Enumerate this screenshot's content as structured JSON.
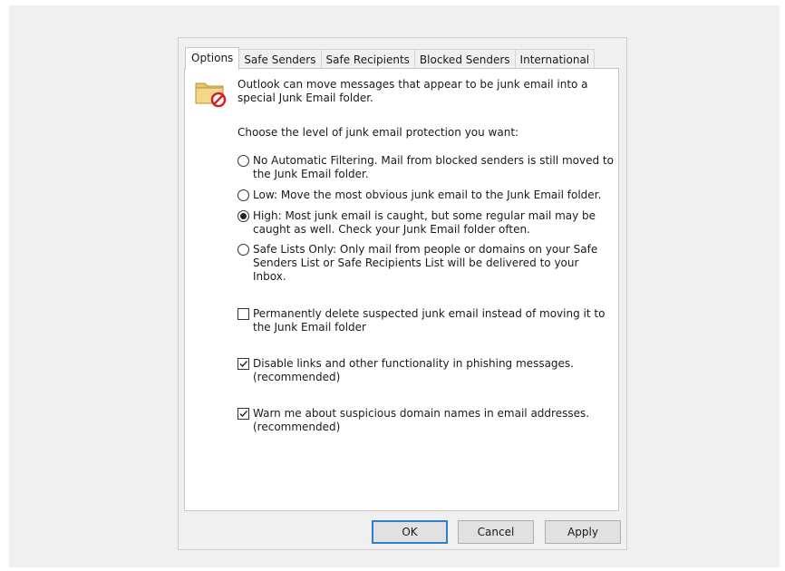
{
  "tabs": [
    {
      "label": "Options",
      "active": true
    },
    {
      "label": "Safe Senders"
    },
    {
      "label": "Safe Recipients"
    },
    {
      "label": "Blocked Senders"
    },
    {
      "label": "International"
    }
  ],
  "intro": "Outlook can move messages that appear to be junk email into a special Junk Email folder.",
  "prompt": "Choose the level of junk email protection you want:",
  "levels": [
    {
      "label": "No Automatic Filtering. Mail from blocked senders is still moved to the Junk Email folder.",
      "checked": false
    },
    {
      "label": "Low: Move the most obvious junk email to the Junk Email folder.",
      "checked": false
    },
    {
      "label": "High: Most junk email is caught, but some regular mail may be caught as well. Check your Junk Email folder often.",
      "checked": true
    },
    {
      "label": "Safe Lists Only: Only mail from people or domains on your Safe Senders List or Safe Recipients List will be delivered to your Inbox.",
      "checked": false
    }
  ],
  "checks": [
    {
      "label": "Permanently delete suspected junk email instead of moving it to the Junk Email folder",
      "checked": false
    },
    {
      "label": "Disable links and other functionality in phishing messages. (recommended)",
      "checked": true
    },
    {
      "label": "Warn me about suspicious domain names in email addresses. (recommended)",
      "checked": true
    }
  ],
  "buttons": {
    "ok": "OK",
    "cancel": "Cancel",
    "apply": "Apply"
  },
  "icons": {
    "junk_folder": "junk-folder-icon"
  },
  "colors": {
    "accent": "#2f7fcf",
    "block_red": "#d42020",
    "folder": "#e8c46a"
  }
}
